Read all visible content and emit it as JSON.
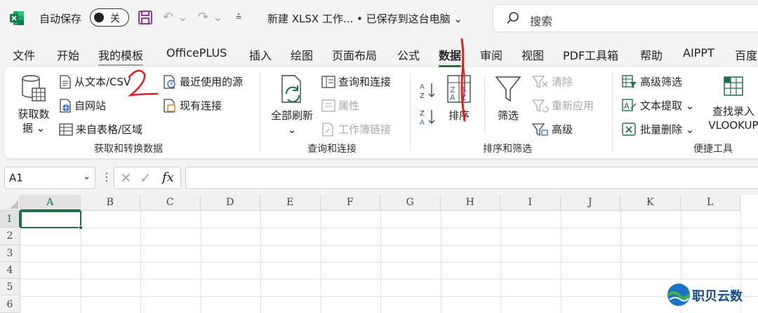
{
  "titlebar": {
    "autosave_label": "自动保存",
    "autosave_state": "关",
    "document_title": "新建 XLSX 工作...  • 已保存到这台电脑 ⌄",
    "search_placeholder": "搜索"
  },
  "tabs": [
    "文件",
    "开始",
    "我的模板",
    "OfficePLUS",
    "插入",
    "绘图",
    "页面布局",
    "公式",
    "数据",
    "审阅",
    "视图",
    "PDF工具箱",
    "帮助",
    "AIPPT",
    "百度"
  ],
  "active_tab": "数据",
  "ribbon": {
    "get_data": {
      "big_button_line1": "获取数",
      "big_button_line2": "据 ⌄",
      "from_text_csv": "从文本/CSV",
      "from_web": "自网站",
      "from_table": "来自表格/区域",
      "recent_sources": "最近使用的源",
      "existing_connections": "现有连接",
      "group_label": "获取和转换数据"
    },
    "queries": {
      "refresh_all": "全部刷新",
      "refresh_all_dd": "⌄",
      "queries_connections": "查询和连接",
      "properties": "属性",
      "edit_links": "工作簿链接",
      "group_label": "查询和连接"
    },
    "sort_filter": {
      "sort_az": "A→Z",
      "sort_za": "Z→A",
      "sort": "排序",
      "filter": "筛选",
      "clear": "清除",
      "reapply": "重新应用",
      "advanced": "高级",
      "group_label": "排序和筛选"
    },
    "tools": {
      "advanced_filter": "高级筛选",
      "text_extract": "文本提取 ⌄",
      "bulk_delete": "批量删除 ⌄",
      "lookup_line1": "查找录入",
      "lookup_line2": "VLOOKUP",
      "group_label": "便捷工具"
    }
  },
  "formula_bar": {
    "name_box": "A1",
    "fx": "fx",
    "formula": ""
  },
  "grid": {
    "columns": [
      "A",
      "B",
      "C",
      "D",
      "E",
      "F",
      "G",
      "H",
      "I",
      "J",
      "K",
      "L"
    ],
    "rows": [
      "1",
      "2",
      "3",
      "4",
      "5",
      "6"
    ],
    "selected_cell": "A1"
  },
  "watermark": {
    "text": "职贝云数"
  },
  "annotations": {
    "mark_2": "2",
    "mark_1": "1"
  }
}
